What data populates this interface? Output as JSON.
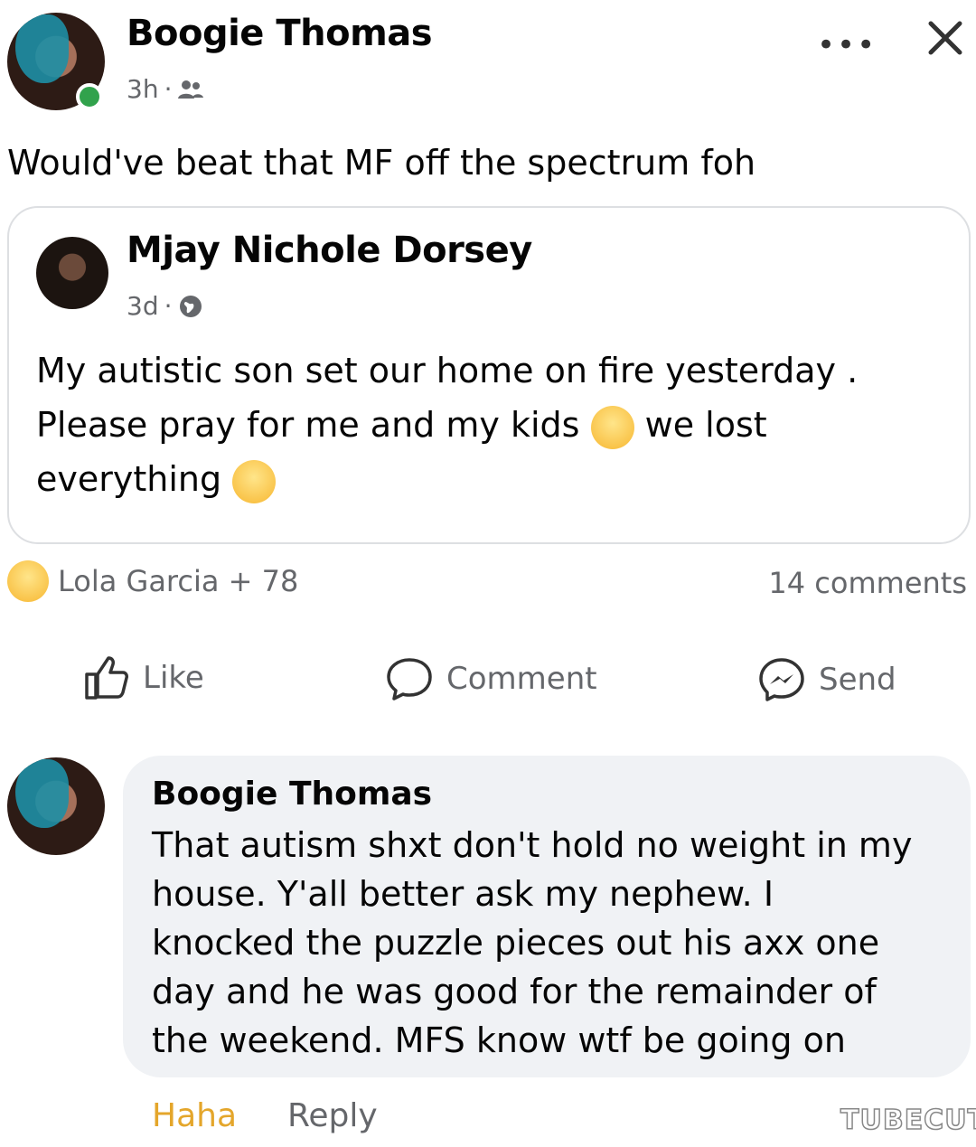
{
  "post": {
    "author": "Boogie Thomas",
    "time": "3h",
    "text": "Would've beat that MF off the spectrum foh"
  },
  "shared": {
    "author": "Mjay Nichole Dorsey",
    "time": "3d",
    "line1": "My autistic son set our home on fire yesterday .",
    "line2a": "Please pray for me and my kids",
    "line2b": "we lost",
    "line3": "everything"
  },
  "reactions": {
    "names": "Lola Garcia + 78",
    "comments": "14 comments"
  },
  "actions": {
    "like": "Like",
    "comment": "Comment",
    "send": "Send"
  },
  "comment": {
    "author": "Boogie Thomas",
    "lines": [
      "That autism shxt don't hold no weight in my",
      "house. Y'all better ask my nephew. I",
      "knocked the puzzle pieces out his axx one",
      "day and he was good for the remainder of",
      "the weekend. MFS know wtf be going on"
    ],
    "haha": "Haha",
    "reply": "Reply"
  },
  "watermark": "TUBECUT",
  "icons": [
    "more-icon",
    "close-icon",
    "friends-icon",
    "globe-icon",
    "laughing-emoji-icon",
    "sad-emoji-icon",
    "like-icon",
    "comment-icon",
    "send-icon"
  ],
  "colors": {
    "online": "#31a24c",
    "secondary_text": "#65676b",
    "haha": "#e4a62b",
    "bubble": "#f0f2f5"
  }
}
